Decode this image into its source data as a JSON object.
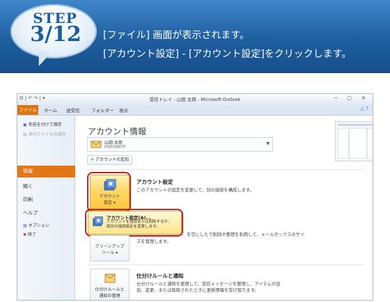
{
  "banner": {
    "step_word": "STEP",
    "step_number": "3/12",
    "line1": "[ファイル] 画面が表示されます。",
    "line2": "[アカウント設定] - [アカウント設定]をクリックします。"
  },
  "window": {
    "title": "受信トレイ - 山田 太郎 - Microsoft Outlook",
    "quick_access": "O | ↶ ↷ | ▾",
    "window_buttons": "─ ▢ ✕",
    "tabs": [
      "ファイル",
      "ホーム",
      "送受信",
      "フォルダー",
      "表示"
    ],
    "ribbon_right": "△ ?"
  },
  "nav": {
    "items": [
      {
        "label": "名前を付けて保存"
      },
      {
        "label": "添付ファイルの保存"
      },
      {
        "label": "情報"
      },
      {
        "label": "開く"
      },
      {
        "label": "印刷"
      },
      {
        "label": "ヘルプ"
      },
      {
        "label": "オプション"
      },
      {
        "label": "終了"
      }
    ]
  },
  "main": {
    "heading": "アカウント情報",
    "account_name": "山田 太郎",
    "account_type": "POP/SMTP",
    "add_account": "アカウントの追加",
    "account_settings": {
      "button_line1": "アカウント",
      "button_line2": "設定 ▾",
      "title": "アカウント設定",
      "description": "このアカウントの設定を変更して、別の接続を構成します。"
    },
    "dropdown": {
      "title": "アカウント設定(A)...",
      "desc_line1": "アカウントを追加または削除するか、",
      "desc_line2": "既存の接続設定を変更します。"
    },
    "cleanup": {
      "button_line1": "クリーンアップ",
      "button_line2": "ツール ▾",
      "description_line1": "を空にしたり削除や整理を利用して、メールボックスのサイ",
      "description_line2": "ズを管理します。"
    },
    "rules": {
      "button_line1": "仕分けルールと",
      "button_line2": "通知の管理",
      "title": "仕分けルールと通知",
      "description_line1": "仕分けルールと通知を使用して、受信メッセージを整理し、アイテムが追",
      "description_line2": "加、変更、または削除されたときに更新情報を受け取ります。"
    }
  }
}
